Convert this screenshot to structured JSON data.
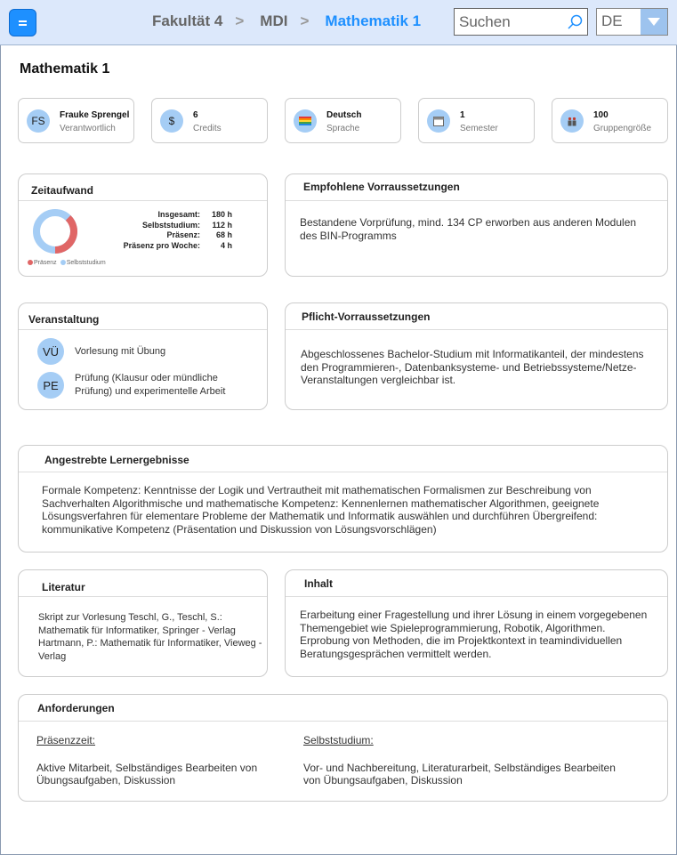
{
  "header": {
    "breadcrumbs": [
      "Fakultät 4",
      "MDI",
      "Mathematik 1"
    ],
    "separator": ">",
    "search_placeholder": "Suchen",
    "language": "DE"
  },
  "page_title": "Mathematik 1",
  "info_cards": [
    {
      "icon": "FS",
      "value": "Frauke Sprengel",
      "label": "Verantwortlich"
    },
    {
      "icon": "$",
      "value": "6",
      "label": "Credits"
    },
    {
      "icon": "flag-icon",
      "value": "Deutsch",
      "label": "Sprache"
    },
    {
      "icon": "calendar-icon",
      "value": "1",
      "label": "Semester"
    },
    {
      "icon": "group-icon",
      "value": "100",
      "label": "Gruppengröße"
    }
  ],
  "zeitaufwand": {
    "title": "Zeitaufwand",
    "stats": [
      {
        "key": "Insgesamt:",
        "value": "180 h"
      },
      {
        "key": "Selbststudium:",
        "value": "112 h"
      },
      {
        "key": "Präsenz:",
        "value": "68 h"
      },
      {
        "key": "Präsenz pro Woche:",
        "value": "4 h"
      }
    ],
    "legend": [
      {
        "name": "Präsenz",
        "color": "#e06666"
      },
      {
        "name": "Selbststudium",
        "color": "#a5cdf5"
      }
    ],
    "donut": {
      "praesenz_hours": 68,
      "selbststudium_hours": 112
    }
  },
  "empfohlene": {
    "title": "Empfohlene Vorraussetzungen",
    "text": "Bestandene Vorprüfung, mind. 134 CP erworben aus anderen Modulen des BIN-Programms"
  },
  "veranstaltung": {
    "title": "Veranstaltung",
    "items": [
      {
        "abbr": "VÜ",
        "text": "Vorlesung mit Übung"
      },
      {
        "abbr": "PE",
        "text": "Prüfung (Klausur oder mündliche Prüfung) und experimentelle Arbeit"
      }
    ]
  },
  "pflicht": {
    "title": "Pflicht-Vorraussetzungen",
    "text": "Abgeschlossenes Bachelor-Studium mit Informatikanteil, der mindestens den Programmieren-, Datenbanksysteme- und Betriebssysteme/Netze-Veranstaltungen vergleichbar ist."
  },
  "lernergebnisse": {
    "title": "Angestrebte Lernergebnisse",
    "text": "Formale Kompetenz: Kenntnisse der Logik und Vertrautheit mit mathematischen Formalismen zur Beschreibung von Sachverhalten Algorithmische und mathematische Kompetenz: Kennenlernen mathematischer Algorithmen, geeignete Lösungsverfahren für elementare Probleme der Mathematik und Informatik auswählen und durchführen Übergreifend: kommunikative Kompetenz (Präsentation und Diskussion von Lösungsvorschlägen)"
  },
  "literatur": {
    "title": "Literatur",
    "text": "Skript zur Vorlesung Teschl, G., Teschl, S.: Mathematik für Informatiker, Springer - Verlag Hartmann, P.: Mathematik für Informatiker, Vieweg - Verlag"
  },
  "inhalt": {
    "title": "Inhalt",
    "text": "Erarbeitung einer Fragestellung und ihrer Lösung in einem vorgegebenen Themengebiet wie Spieleprogrammierung, Robotik, Algorithmen. Erprobung von Methoden, die im Projektkontext in teamindividuellen Beratungsgesprächen vermittelt werden."
  },
  "anforderungen": {
    "title": "Anforderungen",
    "praesenz_heading": "Präsenzzeit:",
    "praesenz_text": "Aktive Mitarbeit, Selbständiges Bearbeiten von Übungsaufgaben, Diskussion",
    "selbst_heading": "Selbststudium:",
    "selbst_text": "Vor- und Nachbereitung, Literaturarbeit, Selbständiges Bearbeiten von Übungsaufgaben, Diskussion"
  },
  "colors": {
    "accent": "#1e90ff",
    "header_bg": "#dce8fb",
    "icon_bg": "#a5cdf5",
    "praesenz": "#e06666"
  }
}
